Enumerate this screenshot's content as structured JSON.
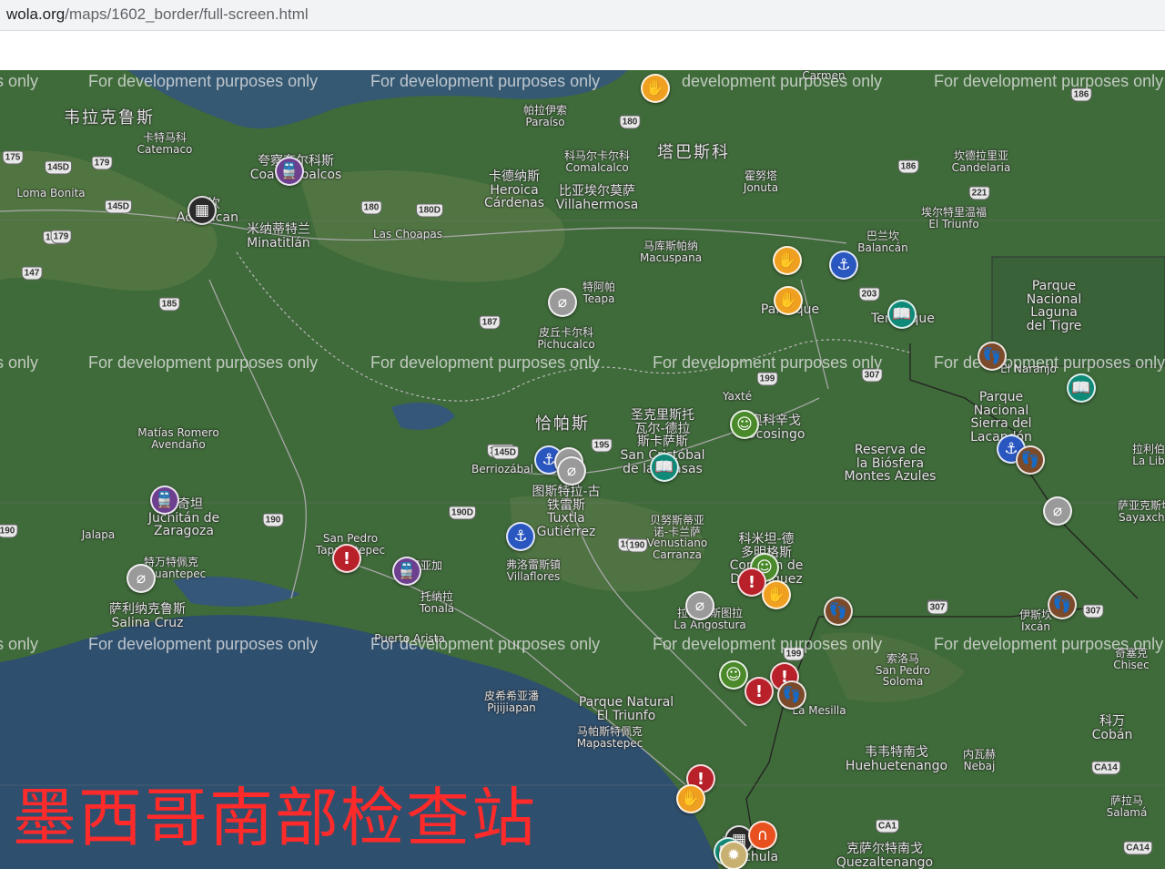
{
  "browser": {
    "url_host": "wola.org",
    "url_path": "/maps/1602_border/full-screen.html"
  },
  "caption": "墨西哥南部检查站",
  "watermark_text": "For development purposes only",
  "watermarks": [
    {
      "text": "s only"
    },
    {
      "text": "For development purposes only"
    },
    {
      "text": "For development purposes only"
    },
    {
      "text": "development purposes only"
    },
    {
      "text": "For development purposes only"
    },
    {
      "text": "s only"
    },
    {
      "text": "For development purposes only"
    },
    {
      "text": "For development purposes only"
    },
    {
      "text": "For development purposes only"
    },
    {
      "text": "For de"
    },
    {
      "text": "opment purposes only"
    },
    {
      "text": "s only"
    },
    {
      "text": "For development purposes only"
    },
    {
      "text": "For development purposes only"
    },
    {
      "text": "For development purposes only"
    },
    {
      "text": "For development purposes only"
    }
  ],
  "map_labels": [
    {
      "text": "韦拉克鲁斯",
      "cls": "big"
    },
    {
      "text": "卡特马科\nCatemaco",
      "cls": "small"
    },
    {
      "text": "帕拉伊索\nParaíso",
      "cls": "small"
    },
    {
      "text": "Loma Bonita",
      "cls": "small"
    },
    {
      "text": "夸察夸尔科斯\nCoatzacoalcos",
      "cls": "med"
    },
    {
      "text": "阿坎\nAcayucan",
      "cls": "med"
    },
    {
      "text": "米纳蒂特兰\nMinatitlán",
      "cls": "med"
    },
    {
      "text": "科马尔卡尔科\nComalcalco",
      "cls": "small"
    },
    {
      "text": "塔巴斯科",
      "cls": "big"
    },
    {
      "text": "卡德纳斯\nHeroica\nCárdenas",
      "cls": "med"
    },
    {
      "text": "比亚埃尔莫萨\nVillahermosa",
      "cls": "med"
    },
    {
      "text": "霍努塔\nJonuta",
      "cls": "small"
    },
    {
      "text": "坎德拉里亚\nCandelaria",
      "cls": "small"
    },
    {
      "text": "埃尔特里温福\nEl Triunfo",
      "cls": "small"
    },
    {
      "text": "Las Choapas",
      "cls": "small"
    },
    {
      "text": "马库斯帕纳\nMacuspana",
      "cls": "small"
    },
    {
      "text": "巴兰坎\nBalancán",
      "cls": "small"
    },
    {
      "text": "特阿帕\nTeapa",
      "cls": "small"
    },
    {
      "text": "皮丘卡尔科\nPichucalco",
      "cls": "small"
    },
    {
      "text": "Palenque",
      "cls": "med"
    },
    {
      "text": "Tenosique",
      "cls": "med"
    },
    {
      "text": "Parque\nNacional\nLaguna\ndel Tigre",
      "cls": "med"
    },
    {
      "text": "El Naranjo",
      "cls": "small"
    },
    {
      "text": "Parque\nNacional\nSierra del\nLacandón",
      "cls": "med"
    },
    {
      "text": "Yaxté",
      "cls": "small"
    },
    {
      "text": "Matías Romero\nAvendaño",
      "cls": "small"
    },
    {
      "text": "恰帕斯",
      "cls": "big"
    },
    {
      "text": "圣克里斯托\n瓦尔-德拉\n斯卡萨斯\nSan Cristóbal\nde las Casas",
      "cls": "med"
    },
    {
      "text": "奥科辛戈\nOcosingo",
      "cls": "med"
    },
    {
      "text": "Reserva de\nla Biósfera\nMontes Azules",
      "cls": "med"
    },
    {
      "text": "拉利伯\nLa Lib",
      "cls": "small"
    },
    {
      "text": "Berriozábal",
      "cls": "small"
    },
    {
      "text": "图斯特拉-古\n铁雷斯\nTuxtla\nGutiérrez",
      "cls": "med"
    },
    {
      "text": "胡奇坦\nJuchitán de\nZaragoza",
      "cls": "med"
    },
    {
      "text": "Jalapa",
      "cls": "small"
    },
    {
      "text": "San Pedro\nTapanatepec",
      "cls": "small"
    },
    {
      "text": "特万特佩克\nTehuantepec",
      "cls": "small"
    },
    {
      "text": "阿里亚加",
      "cls": "small"
    },
    {
      "text": "弗洛雷斯镇\nVillaflores",
      "cls": "small"
    },
    {
      "text": "贝努斯蒂亚\n诺-卡兰萨\nVenustiano\nCarranza",
      "cls": "small"
    },
    {
      "text": "科米坦-德\n多明格斯\nComitán de\nDomínguez",
      "cls": "med"
    },
    {
      "text": "萨亚克斯切\nSayaxché",
      "cls": "small"
    },
    {
      "text": "托纳拉\nTonalá",
      "cls": "small"
    },
    {
      "text": "萨利纳克鲁斯\nSalina Cruz",
      "cls": "med"
    },
    {
      "text": "Puerto Arista",
      "cls": "small"
    },
    {
      "text": "拉安戈斯图拉\nLa Angostura",
      "cls": "small"
    },
    {
      "text": "伊斯坎\nIxcán",
      "cls": "small"
    },
    {
      "text": "奇塞克\nChisec",
      "cls": "small"
    },
    {
      "text": "索洛马\nSan Pedro\nSoloma",
      "cls": "small"
    },
    {
      "text": "La Mesilla",
      "cls": "small"
    },
    {
      "text": "皮希希亚潘\nPijijiapan",
      "cls": "small"
    },
    {
      "text": "Parque Natural\nEl Triunfo",
      "cls": "med"
    },
    {
      "text": "马帕斯特佩克\nMapastepec",
      "cls": "small"
    },
    {
      "text": "科万\nCobán",
      "cls": "med"
    },
    {
      "text": "韦韦特南戈\nHuehuetenango",
      "cls": "med"
    },
    {
      "text": "内瓦赫\nNebaj",
      "cls": "small"
    },
    {
      "text": "萨拉马\nSalamá",
      "cls": "small"
    },
    {
      "text": "塔帕丘拉\nTapachula",
      "cls": "med"
    },
    {
      "text": "克萨尔特南戈\nQuezaltenango",
      "cls": "med"
    },
    {
      "text": "Carmen",
      "cls": "small"
    }
  ],
  "road_shields": [
    "175",
    "145D",
    "179",
    "145D",
    "145D",
    "179",
    "147",
    "185",
    "180",
    "180D",
    "180",
    "186",
    "186",
    "221",
    "145D",
    "187",
    "203",
    "199",
    "307",
    "195",
    "145D",
    "190",
    "190",
    "190D",
    "190",
    "190",
    "199",
    "307",
    "307",
    "307",
    "186",
    "CA14",
    "CA1",
    "CA14"
  ],
  "markers": [
    {
      "type": "hand",
      "icon": "hand-icon",
      "glyph": "✋"
    },
    {
      "type": "train",
      "icon": "train-icon",
      "glyph": "🚆"
    },
    {
      "type": "fence",
      "icon": "fence-icon",
      "glyph": "▦"
    },
    {
      "type": "hand",
      "icon": "hand-icon",
      "glyph": "✋"
    },
    {
      "type": "anchor",
      "icon": "anchor-icon",
      "glyph": "⚓"
    },
    {
      "type": "compass",
      "icon": "compass-icon",
      "glyph": "⌀"
    },
    {
      "type": "hand",
      "icon": "hand-icon",
      "glyph": "✋"
    },
    {
      "type": "book",
      "icon": "book-icon",
      "glyph": "📖"
    },
    {
      "type": "feet",
      "icon": "footprints-icon",
      "glyph": "👣"
    },
    {
      "type": "book",
      "icon": "book-icon",
      "glyph": "📖"
    },
    {
      "type": "soldier",
      "icon": "soldier-icon",
      "glyph": "☺"
    },
    {
      "type": "anchor",
      "icon": "anchor-icon",
      "glyph": "⚓"
    },
    {
      "type": "compass",
      "icon": "compass-icon",
      "glyph": "⌀"
    },
    {
      "type": "compass",
      "icon": "compass-icon",
      "glyph": "⌀"
    },
    {
      "type": "book",
      "icon": "book-icon",
      "glyph": "📖"
    },
    {
      "type": "anchor",
      "icon": "anchor-icon",
      "glyph": "⚓"
    },
    {
      "type": "feet",
      "icon": "footprints-icon",
      "glyph": "👣"
    },
    {
      "type": "compass",
      "icon": "compass-icon",
      "glyph": "⌀"
    },
    {
      "type": "train",
      "icon": "train-icon",
      "glyph": "🚆"
    },
    {
      "type": "anchor",
      "icon": "anchor-icon",
      "glyph": "⚓"
    },
    {
      "type": "compass",
      "icon": "compass-icon",
      "glyph": "⌀"
    },
    {
      "type": "warn",
      "icon": "warning-icon",
      "glyph": "!"
    },
    {
      "type": "train",
      "icon": "train-icon",
      "glyph": "🚆"
    },
    {
      "type": "soldier",
      "icon": "soldier-icon",
      "glyph": "☺"
    },
    {
      "type": "warn",
      "icon": "warning-icon",
      "glyph": "!"
    },
    {
      "type": "hand",
      "icon": "hand-icon",
      "glyph": "✋"
    },
    {
      "type": "compass",
      "icon": "compass-icon",
      "glyph": "⌀"
    },
    {
      "type": "feet",
      "icon": "footprints-icon",
      "glyph": "👣"
    },
    {
      "type": "feet",
      "icon": "footprints-icon",
      "glyph": "👣"
    },
    {
      "type": "soldier",
      "icon": "soldier-icon",
      "glyph": "☺"
    },
    {
      "type": "warn",
      "icon": "warning-icon",
      "glyph": "!"
    },
    {
      "type": "warn",
      "icon": "warning-icon",
      "glyph": "!"
    },
    {
      "type": "feet",
      "icon": "footprints-icon",
      "glyph": "👣"
    },
    {
      "type": "warn",
      "icon": "warning-icon",
      "glyph": "!"
    },
    {
      "type": "hand",
      "icon": "hand-icon",
      "glyph": "✋"
    },
    {
      "type": "fence",
      "icon": "fence-icon",
      "glyph": "▦"
    },
    {
      "type": "magnet",
      "icon": "magnet-icon",
      "glyph": "∩"
    },
    {
      "type": "book",
      "icon": "book-icon",
      "glyph": "📖"
    },
    {
      "type": "star",
      "icon": "star-icon",
      "glyph": "✹"
    }
  ],
  "colors": {
    "ocean": "#2f4f6e",
    "land": "#3f6a3a",
    "caption": "#ff2a2a"
  }
}
